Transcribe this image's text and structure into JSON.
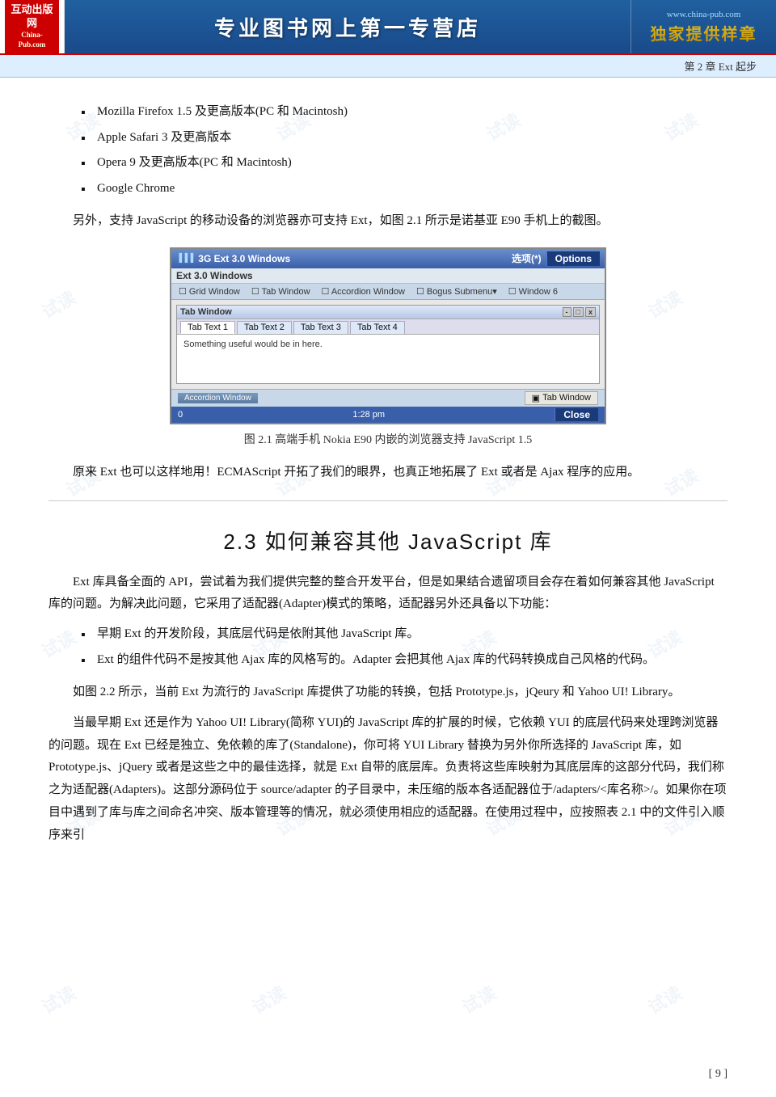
{
  "header": {
    "logo_line1": "互动出版网",
    "logo_line2": "China-Pub.com",
    "center_title": "专业图书网上第一专营店",
    "right_url": "www.china-pub.com",
    "right_banner": "独家提供样章"
  },
  "chapter_band": "第 2 章    Ext 起步",
  "bullet_items": [
    "Mozilla Firefox 1.5 及更高版本(PC 和 Macintosh)",
    "Apple Safari 3 及更高版本",
    "Opera 9 及更高版本(PC 和 Macintosh)",
    "Google Chrome"
  ],
  "para1": "另外，支持 JavaScript 的移动设备的浏览器亦可支持 Ext，如图 2.1 所示是诺基亚 E90 手机上的截图。",
  "figure": {
    "titlebar_left": "3G  Ext 3.0 Windows",
    "titlebar_signal": "选项(*)",
    "titlebar_options": "Options",
    "subtitle": "Ext 3.0 Windows",
    "menu_items": [
      "Grid Window",
      "Tab Window",
      "Accordion Window",
      "Bogus Submenu▾",
      "Window 6"
    ],
    "inner_title": "Tab Window",
    "inner_win_btns": [
      "-",
      "□",
      "x"
    ],
    "tabs": [
      "Tab Text 1",
      "Tab Text 2",
      "Tab Text 3",
      "Tab Text 4"
    ],
    "active_tab": "Tab Text 1",
    "tab_content": "Something useful would be in here.",
    "bottom_accordion": "Accordion Window",
    "bottom_tabwin": "Tab Window",
    "status_left": "0",
    "status_time": "1:28 pm",
    "status_close": "Close",
    "caption": "图 2.1    高端手机 Nokia E90 内嵌的浏览器支持 JavaScript 1.5"
  },
  "para2": "原来 Ext 也可以这样地用！ECMAScript 开拓了我们的眼界，也真正地拓展了 Ext 或者是 Ajax 程序的应用。",
  "section_heading": "2.3    如何兼容其他 JavaScript 库",
  "para3": "Ext 库具备全面的 API，尝试着为我们提供完整的整合开发平台，但是如果结合遗留项目会存在着如何兼容其他 JavaScript 库的问题。为解决此问题，它采用了适配器(Adapter)模式的策略，适配器另外还具备以下功能：",
  "bullet2_items": [
    "早期 Ext 的开发阶段，其底层代码是依附其他 JavaScript 库。",
    "Ext 的组件代码不是按其他 Ajax 库的风格写的。Adapter 会把其他 Ajax 库的代码转换成自己风格的代码。"
  ],
  "para4": "如图 2.2 所示，当前 Ext 为流行的 JavaScript 库提供了功能的转换，包括 Prototype.js，jQeury 和 Yahoo UI! Library。",
  "para5": "当最早期 Ext 还是作为 Yahoo UI! Library(简称 YUI)的 JavaScript 库的扩展的时候，它依赖 YUI 的底层代码来处理跨浏览器的问题。现在 Ext 已经是独立、免依赖的库了(Standalone)，你可将 YUI Library 替换为另外你所选择的 JavaScript 库，如 Prototype.js、jQuery 或者是这些之中的最佳选择，就是 Ext 自带的底层库。负责将这些库映射为其底层库的这部分代码，我们称之为适配器(Adapters)。这部分源码位于 source/adapter 的子目录中，未压缩的版本各适配器位于/adapters/<库名称>/。如果你在项目中遇到了库与库之间命名冲突、版本管理等的情况，就必须使用相应的适配器。在使用过程中，应按照表 2.1 中的文件引入顺序来引",
  "page_number": "[ 9 ]",
  "watermarks": [
    "试读",
    "试读",
    "试读",
    "试读",
    "试读",
    "试读",
    "试读",
    "试读",
    "试读",
    "试读",
    "试读",
    "试读"
  ]
}
